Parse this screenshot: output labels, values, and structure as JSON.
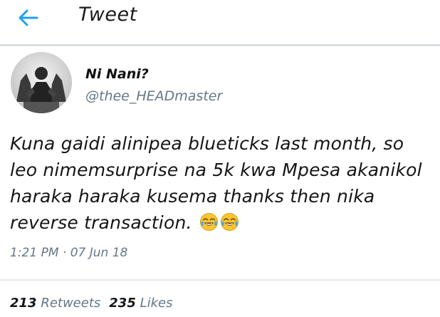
{
  "header": {
    "title": "Tweet",
    "back_icon": "arrow-left-icon",
    "accent_color": "#1da1f2"
  },
  "tweet": {
    "display_name": "Ni Nani?",
    "handle": "@thee_HEADmaster",
    "text_lines": [
      "Kuna gaidi alinipea blueticks last month, so",
      "leo nimemsurprise na 5k kwa Mpesa akanikol",
      "haraka haraka kusema thanks then nika",
      "reverse transaction."
    ],
    "emojis": [
      "face-with-tears-of-joy-icon",
      "face-with-tears-of-joy-icon"
    ],
    "timestamp": "1:21 PM · 07 Jun 18"
  },
  "stats": {
    "retweets_count": "213",
    "retweets_label": "Retweets",
    "likes_count": "235",
    "likes_label": "Likes"
  }
}
